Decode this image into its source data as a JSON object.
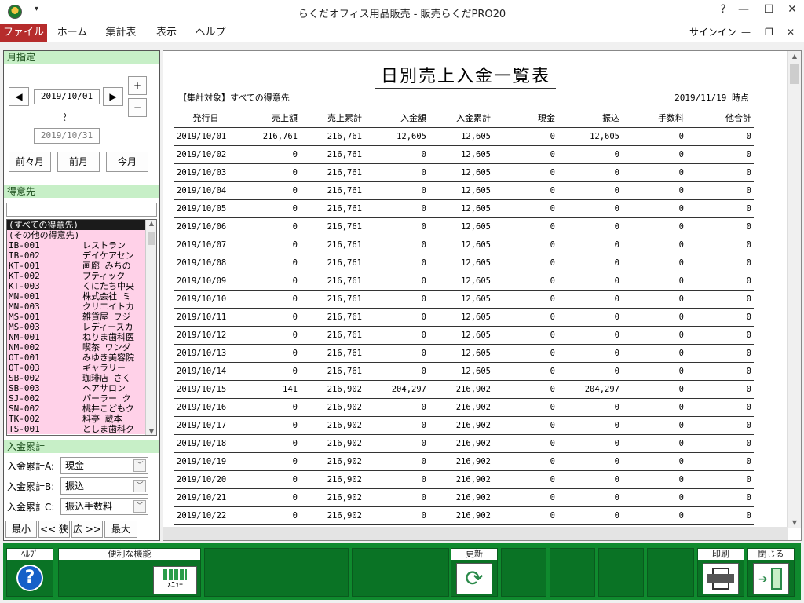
{
  "window": {
    "title": "らくだオフィス用品販売 - 販売らくだPRO20",
    "help": "?",
    "minimize": "—",
    "maximize": "☐",
    "close": "✕"
  },
  "menu": {
    "items": [
      "ファイル",
      "ホーム",
      "集計表",
      "表示",
      "ヘルプ"
    ],
    "signin": "サインイン"
  },
  "month": {
    "header": "月指定",
    "start": "2019/10/01",
    "tilde": "〜",
    "end": "2019/10/31",
    "plus": "+",
    "minus": "−",
    "prev2": "前々月",
    "prev": "前月",
    "current": "今月"
  },
  "customer": {
    "header": "得意先",
    "search_value": "",
    "list": [
      {
        "code": "(すべての得意先)",
        "name": ""
      },
      {
        "code": "(その他の得意先)",
        "name": ""
      },
      {
        "code": "IB-001",
        "name": "レストラン"
      },
      {
        "code": "IB-002",
        "name": "デイケアセン"
      },
      {
        "code": "KT-001",
        "name": "画廊 みちの"
      },
      {
        "code": "KT-002",
        "name": "ブティック"
      },
      {
        "code": "KT-003",
        "name": "くにたち中央"
      },
      {
        "code": "MN-001",
        "name": "株式会社 ミ"
      },
      {
        "code": "MN-003",
        "name": "クリエイトカ"
      },
      {
        "code": "MS-001",
        "name": "雑貨屋 フジ"
      },
      {
        "code": "MS-003",
        "name": "レディースカ"
      },
      {
        "code": "NM-001",
        "name": "ねりま歯科医"
      },
      {
        "code": "NM-002",
        "name": "喫茶 ワンダ"
      },
      {
        "code": "OT-001",
        "name": "みゆき美容院"
      },
      {
        "code": "OT-003",
        "name": "ギャラリー"
      },
      {
        "code": "SB-002",
        "name": "珈琲店 さく"
      },
      {
        "code": "SB-003",
        "name": "ヘアサロン"
      },
      {
        "code": "SJ-002",
        "name": "パーラー ク"
      },
      {
        "code": "SN-002",
        "name": "桃井こどもク"
      },
      {
        "code": "TK-002",
        "name": "料亭 蔵本"
      },
      {
        "code": "TS-001",
        "name": "としま歯科ク"
      }
    ]
  },
  "cumulative": {
    "header": "入金累計",
    "a_label": "入金累計A:",
    "a_value": "現金",
    "b_label": "入金累計B:",
    "b_value": "振込",
    "c_label": "入金累計C:",
    "c_value": "振込手数料",
    "min": "最小",
    "narrow": "<< 狭",
    "wide": "広 >>",
    "max": "最大"
  },
  "report": {
    "title": "日別売上入金一覧表",
    "target": "【集計対象】すべての得意先",
    "as_of": "2019/11/19 時点",
    "columns": [
      "発行日",
      "売上額",
      "売上累計",
      "入金額",
      "入金累計",
      "現金",
      "振込",
      "手数料",
      "他合計"
    ],
    "rows": [
      [
        "2019/10/01",
        "216,761",
        "216,761",
        "12,605",
        "12,605",
        "0",
        "12,605",
        "0",
        "0"
      ],
      [
        "2019/10/02",
        "0",
        "216,761",
        "0",
        "12,605",
        "0",
        "0",
        "0",
        "0"
      ],
      [
        "2019/10/03",
        "0",
        "216,761",
        "0",
        "12,605",
        "0",
        "0",
        "0",
        "0"
      ],
      [
        "2019/10/04",
        "0",
        "216,761",
        "0",
        "12,605",
        "0",
        "0",
        "0",
        "0"
      ],
      [
        "2019/10/05",
        "0",
        "216,761",
        "0",
        "12,605",
        "0",
        "0",
        "0",
        "0"
      ],
      [
        "2019/10/06",
        "0",
        "216,761",
        "0",
        "12,605",
        "0",
        "0",
        "0",
        "0"
      ],
      [
        "2019/10/07",
        "0",
        "216,761",
        "0",
        "12,605",
        "0",
        "0",
        "0",
        "0"
      ],
      [
        "2019/10/08",
        "0",
        "216,761",
        "0",
        "12,605",
        "0",
        "0",
        "0",
        "0"
      ],
      [
        "2019/10/09",
        "0",
        "216,761",
        "0",
        "12,605",
        "0",
        "0",
        "0",
        "0"
      ],
      [
        "2019/10/10",
        "0",
        "216,761",
        "0",
        "12,605",
        "0",
        "0",
        "0",
        "0"
      ],
      [
        "2019/10/11",
        "0",
        "216,761",
        "0",
        "12,605",
        "0",
        "0",
        "0",
        "0"
      ],
      [
        "2019/10/12",
        "0",
        "216,761",
        "0",
        "12,605",
        "0",
        "0",
        "0",
        "0"
      ],
      [
        "2019/10/13",
        "0",
        "216,761",
        "0",
        "12,605",
        "0",
        "0",
        "0",
        "0"
      ],
      [
        "2019/10/14",
        "0",
        "216,761",
        "0",
        "12,605",
        "0",
        "0",
        "0",
        "0"
      ],
      [
        "2019/10/15",
        "141",
        "216,902",
        "204,297",
        "216,902",
        "0",
        "204,297",
        "0",
        "0"
      ],
      [
        "2019/10/16",
        "0",
        "216,902",
        "0",
        "216,902",
        "0",
        "0",
        "0",
        "0"
      ],
      [
        "2019/10/17",
        "0",
        "216,902",
        "0",
        "216,902",
        "0",
        "0",
        "0",
        "0"
      ],
      [
        "2019/10/18",
        "0",
        "216,902",
        "0",
        "216,902",
        "0",
        "0",
        "0",
        "0"
      ],
      [
        "2019/10/19",
        "0",
        "216,902",
        "0",
        "216,902",
        "0",
        "0",
        "0",
        "0"
      ],
      [
        "2019/10/20",
        "0",
        "216,902",
        "0",
        "216,902",
        "0",
        "0",
        "0",
        "0"
      ],
      [
        "2019/10/21",
        "0",
        "216,902",
        "0",
        "216,902",
        "0",
        "0",
        "0",
        "0"
      ],
      [
        "2019/10/22",
        "0",
        "216,902",
        "0",
        "216,902",
        "0",
        "0",
        "0",
        "0"
      ]
    ]
  },
  "toolbar": {
    "help": "ﾍﾙﾌﾟ",
    "tools": "便利な機能",
    "menu_label": "ﾒﾆｭｰ",
    "refresh": "更新",
    "print": "印刷",
    "close": "閉じる"
  }
}
